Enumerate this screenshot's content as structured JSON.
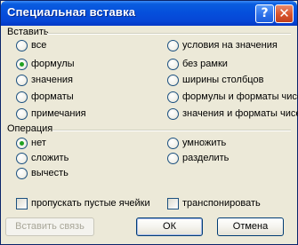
{
  "window": {
    "title": "Специальная вставка",
    "help_glyph": "?",
    "close_glyph": "✕"
  },
  "paste": {
    "label": "Вставить",
    "options": [
      {
        "label": "все",
        "checked": false
      },
      {
        "label": "формулы",
        "checked": true
      },
      {
        "label": "значения",
        "checked": false
      },
      {
        "label": "форматы",
        "checked": false
      },
      {
        "label": "примечания",
        "checked": false
      },
      {
        "label": "условия на значения",
        "checked": false
      },
      {
        "label": "без рамки",
        "checked": false
      },
      {
        "label": "ширины столбцов",
        "checked": false
      },
      {
        "label": "формулы и форматы чисел",
        "checked": false
      },
      {
        "label": "значения и форматы чисел",
        "checked": false
      }
    ]
  },
  "operation": {
    "label": "Операция",
    "options": [
      {
        "label": "нет",
        "checked": true
      },
      {
        "label": "сложить",
        "checked": false
      },
      {
        "label": "вычесть",
        "checked": false
      },
      {
        "label": "умножить",
        "checked": false
      },
      {
        "label": "разделить",
        "checked": false
      }
    ]
  },
  "checks": {
    "skip_blanks": {
      "label": "пропускать пустые ячейки",
      "checked": false
    },
    "transpose": {
      "label": "транспонировать",
      "checked": false
    }
  },
  "buttons": {
    "paste_link": "Вставить связь",
    "ok": "ОК",
    "cancel": "Отмена"
  }
}
